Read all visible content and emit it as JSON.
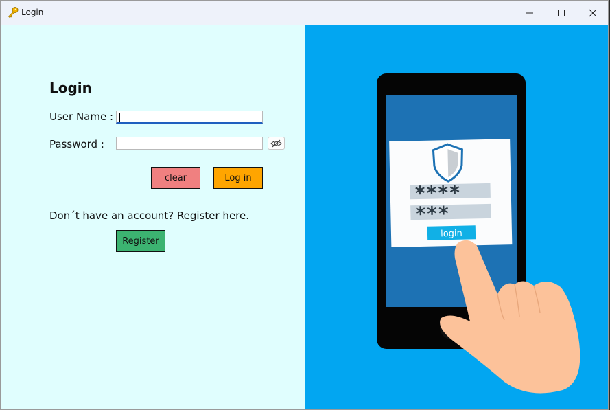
{
  "window": {
    "title": "Login",
    "icon": "key-icon"
  },
  "form": {
    "heading": "Login",
    "username_label": "User Name :",
    "username_value": "",
    "password_label": "Password :",
    "password_value": "",
    "toggle_icon": "eye-slash-icon",
    "clear_label": "clear",
    "login_label": "Log in",
    "register_prompt": "Don´t have an account? Register here.",
    "register_label": "Register"
  },
  "illustration": {
    "stars_line1": "****",
    "stars_line2": "***",
    "button_text": "login"
  },
  "colors": {
    "left_bg": "#e0fefe",
    "right_bg": "#02a6f1",
    "clear_btn": "#f08080",
    "login_btn": "#ffa500",
    "register_btn": "#3cb371"
  }
}
